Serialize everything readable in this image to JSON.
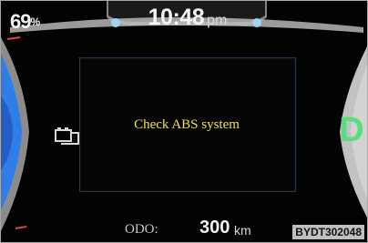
{
  "status": {
    "battery_percent": "69",
    "battery_unit": "%",
    "time": "10:48",
    "ampm": "pm"
  },
  "panel": {
    "message": "Check ABS system",
    "warning_icon": "battery-warning-icon"
  },
  "drive": {
    "gear": "D"
  },
  "odometer": {
    "label": "ODO:",
    "value": "300",
    "unit": "km"
  },
  "figure": {
    "code": "BYDT302048"
  },
  "colors": {
    "message": "#f0e24a",
    "gear": "#55e07b",
    "blue_gauge": "#2f7de8",
    "background": "#030303"
  }
}
